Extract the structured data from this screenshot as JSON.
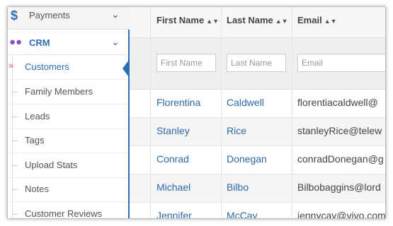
{
  "sidebar": {
    "payments": {
      "label": "Payments",
      "icon": "dollar-icon"
    },
    "crm": {
      "label": "CRM",
      "icon": "users-icon"
    },
    "items": [
      {
        "label": "Customers",
        "active": true
      },
      {
        "label": "Family Members"
      },
      {
        "label": "Leads"
      },
      {
        "label": "Tags"
      },
      {
        "label": "Upload Stats"
      },
      {
        "label": "Notes"
      },
      {
        "label": "Customer Reviews"
      }
    ]
  },
  "table": {
    "columns": [
      {
        "label": "First Name",
        "placeholder": "First Name"
      },
      {
        "label": "Last Name",
        "placeholder": "Last Name"
      },
      {
        "label": "Email",
        "placeholder": "Email"
      }
    ],
    "rows": [
      {
        "first": "Florentina",
        "last": "Caldwell",
        "email": "florentiacaldwell@"
      },
      {
        "first": "Stanley",
        "last": "Rice",
        "email": "stanleyRice@telew"
      },
      {
        "first": "Conrad",
        "last": "Donegan",
        "email": "conradDonegan@g"
      },
      {
        "first": "Michael",
        "last": "Bilbo",
        "email": "Bilbobaggins@lord"
      },
      {
        "first": "Jennifer",
        "last": "McCay",
        "email": "jennycay@vivo.com"
      }
    ]
  },
  "colors": {
    "accent": "#2b6fb6",
    "link": "#2d6aa8",
    "active_marker": "#d9534f"
  }
}
